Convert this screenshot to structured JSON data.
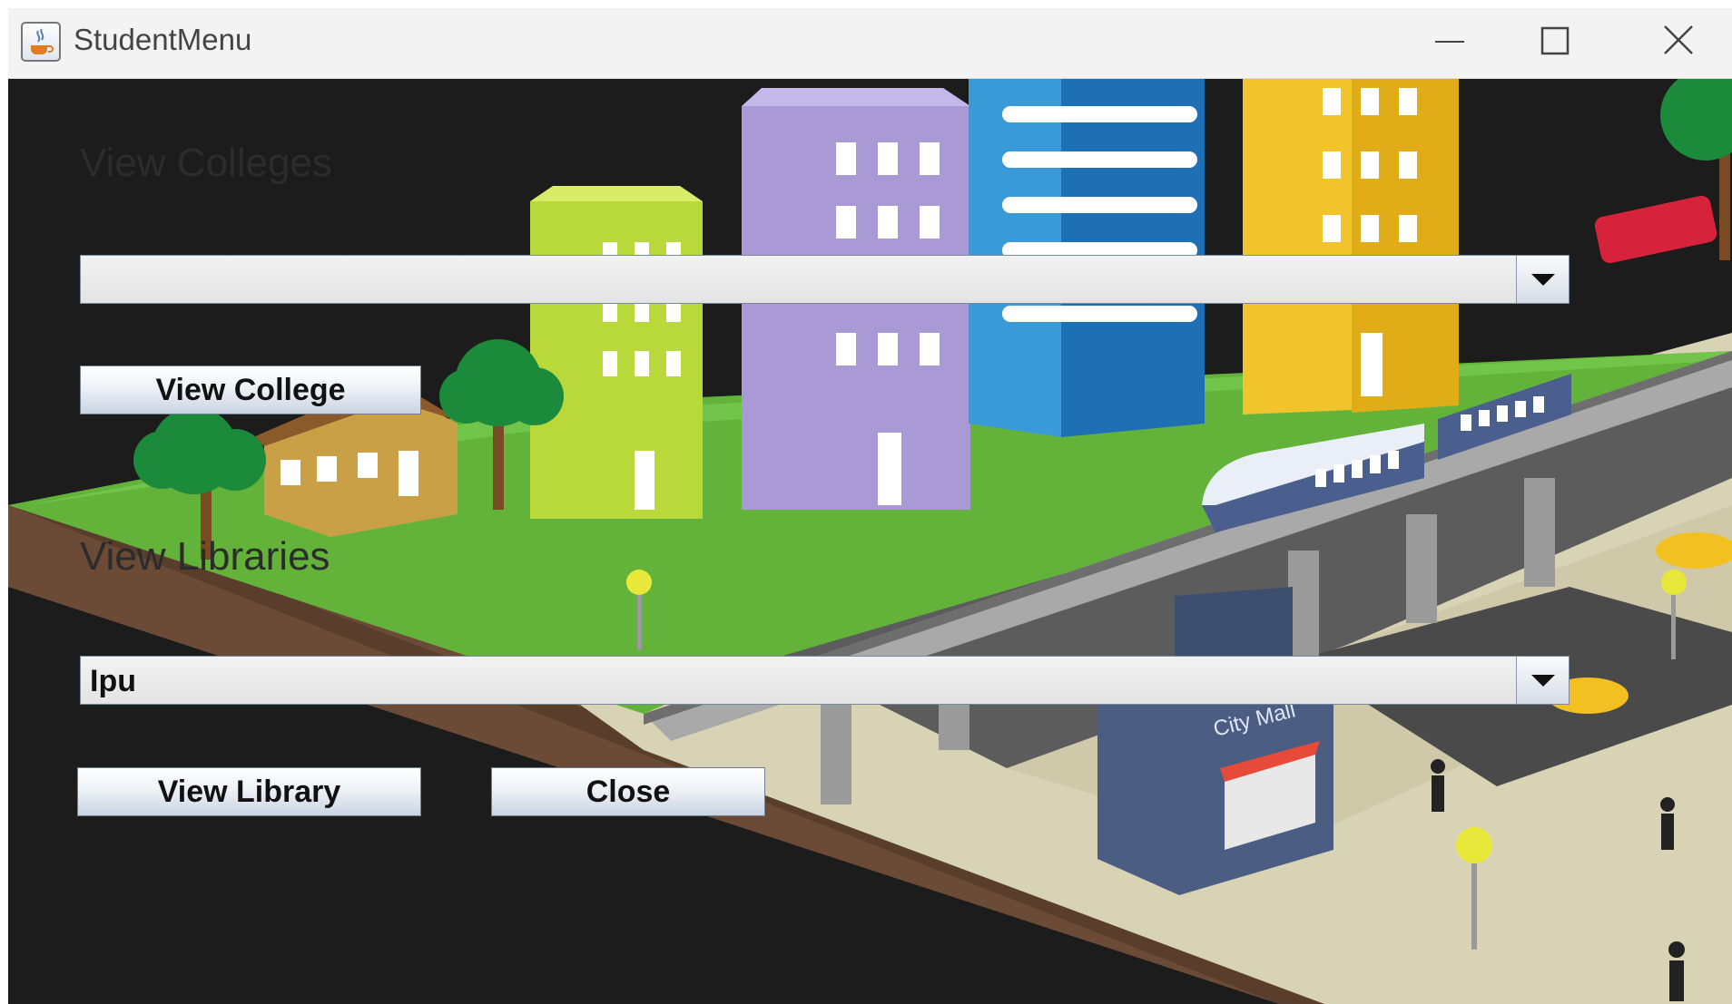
{
  "window": {
    "title": "StudentMenu",
    "app_icon": "java-icon",
    "controls": [
      "minimize-icon",
      "maximize-icon",
      "close-icon"
    ]
  },
  "colleges": {
    "heading": "View Colleges",
    "select": {
      "value": ""
    },
    "button_label": "View College"
  },
  "libraries": {
    "heading": "View Libraries",
    "select": {
      "value": "Ipu"
    },
    "button_label": "View Library"
  },
  "close_label": "Close",
  "background": {
    "description_icon": "city-illustration",
    "mall_sign": "City Mall"
  },
  "colors": {
    "titlebar": "#f3f3f3",
    "content_bg": "#1c1c1c",
    "grass": "#63b33a",
    "button_gradient_bottom": "#c9d4e2"
  }
}
